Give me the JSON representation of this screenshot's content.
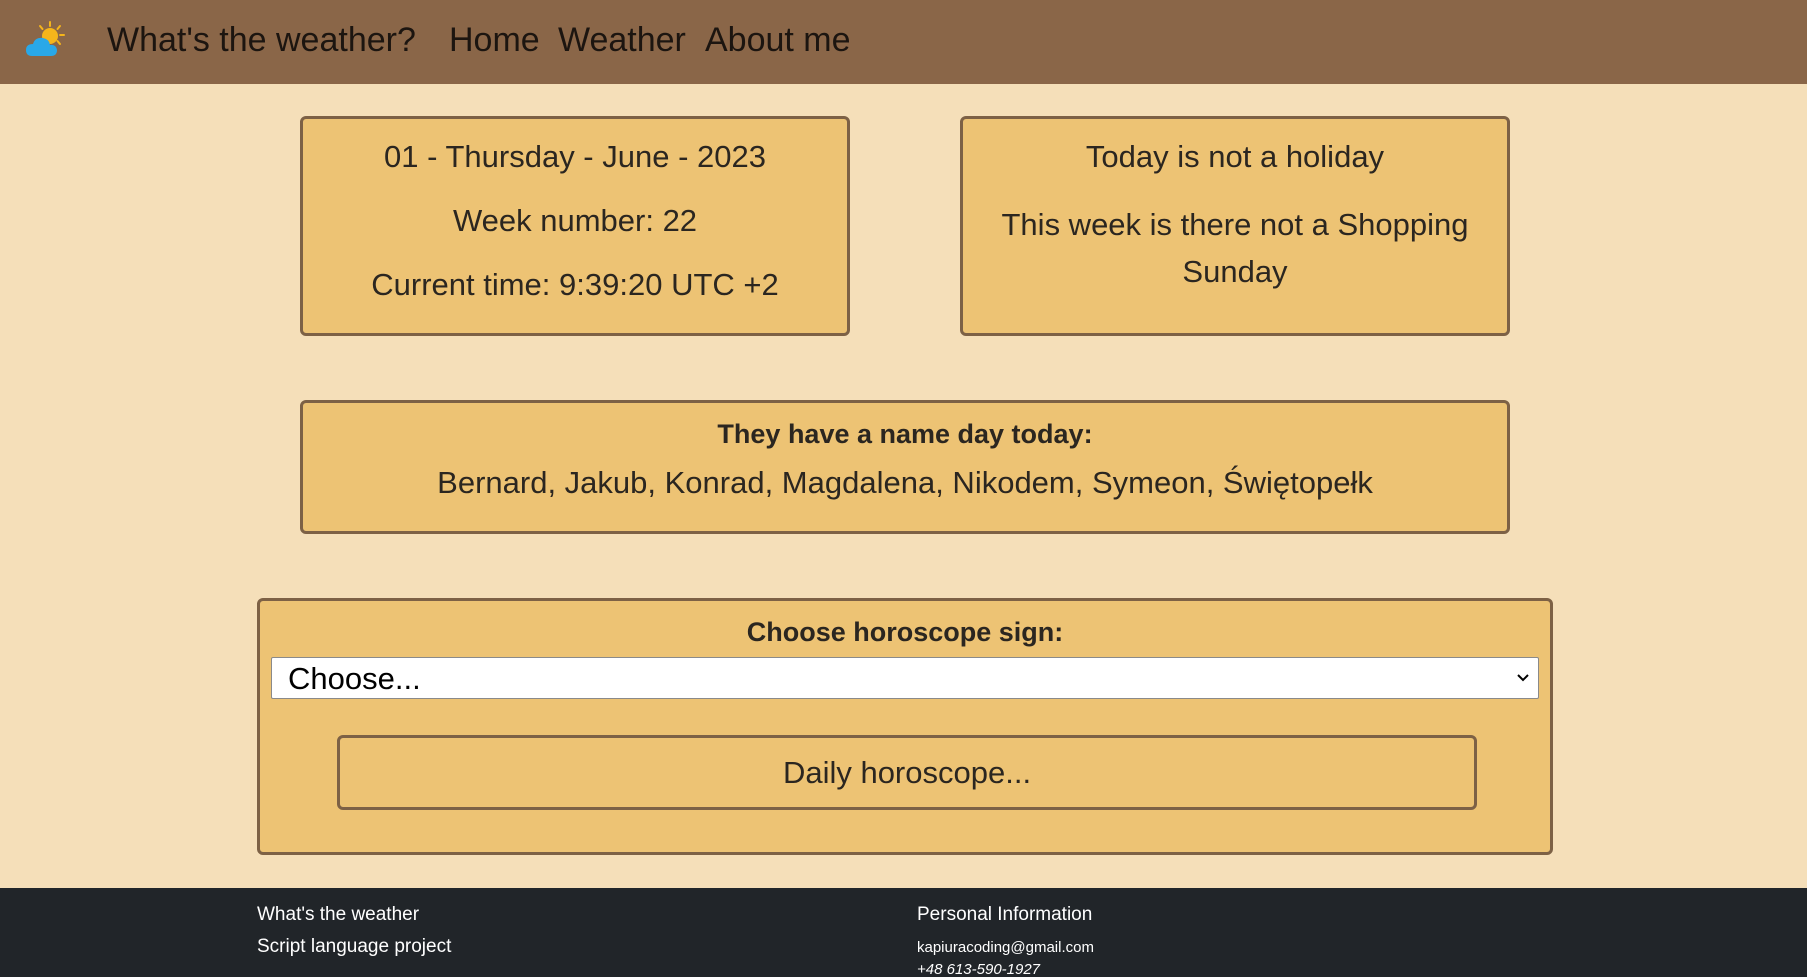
{
  "navbar": {
    "logo_icon": "sun-behind-cloud-icon",
    "brand": "What's the weather?",
    "links": [
      "Home",
      "Weather",
      "About me"
    ]
  },
  "date_card": {
    "date": "01 - Thursday - June - 2023",
    "week": "Week number: 22",
    "time": "Current time: 9:39:20 UTC +2"
  },
  "holiday_card": {
    "holiday": "Today is not a holiday",
    "shopping": "This week is there not a Shopping Sunday"
  },
  "nameday_card": {
    "title": "They have a name day today:",
    "names": "Bernard, Jakub, Konrad, Magdalena, Nikodem, Symeon, Świętopełk"
  },
  "horoscope": {
    "title": "Choose horoscope sign:",
    "select_value": "Choose...",
    "button_label": "Daily horoscope..."
  },
  "footer": {
    "left_title": "What's the weather",
    "left_sub": "Script language project",
    "right_title": "Personal Information",
    "email": "kapiuracoding@gmail.com",
    "phone": "+48 613-590-1927"
  },
  "colors": {
    "navbar": "#8a6648",
    "background": "#f5dfb9",
    "card": "#edc374",
    "card_border": "#7d6145",
    "footer": "#212529"
  }
}
